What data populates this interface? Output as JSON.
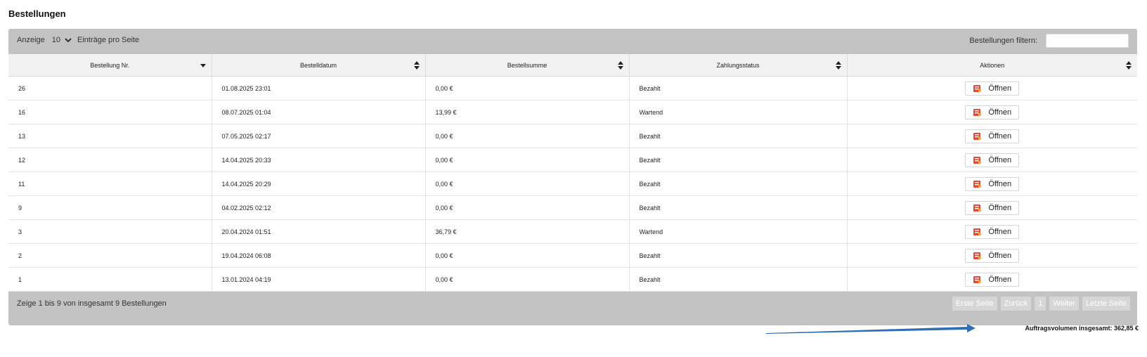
{
  "page": {
    "title": "Bestellungen"
  },
  "controls": {
    "length_prefix": "Anzeige",
    "length_value": "10",
    "length_suffix": "Einträge pro Seite",
    "filter_label": "Bestellungen filtern:",
    "filter_value": ""
  },
  "table": {
    "columns": [
      "Bestellung Nr.",
      "Bestelldatum",
      "Bestellsumme",
      "Zahlungsstatus",
      "Aktionen"
    ],
    "rows": [
      {
        "nr": "26",
        "datum": "01.08.2025 23:01",
        "summe": "0,00 €",
        "status": "Bezahlt",
        "aktion": "Öffnen"
      },
      {
        "nr": "16",
        "datum": "08.07.2025 01:04",
        "summe": "13,99 €",
        "status": "Wartend",
        "aktion": "Öffnen"
      },
      {
        "nr": "13",
        "datum": "07.05.2025 02:17",
        "summe": "0,00 €",
        "status": "Bezahlt",
        "aktion": "Öffnen"
      },
      {
        "nr": "12",
        "datum": "14.04.2025 20:33",
        "summe": "0,00 €",
        "status": "Bezahlt",
        "aktion": "Öffnen"
      },
      {
        "nr": "11",
        "datum": "14.04.2025 20:29",
        "summe": "0,00 €",
        "status": "Bezahlt",
        "aktion": "Öffnen"
      },
      {
        "nr": "9",
        "datum": "04.02.2025 02:12",
        "summe": "0,00 €",
        "status": "Bezahlt",
        "aktion": "Öffnen"
      },
      {
        "nr": "3",
        "datum": "20.04.2024 01:51",
        "summe": "36,79 €",
        "status": "Wartend",
        "aktion": "Öffnen"
      },
      {
        "nr": "2",
        "datum": "19.04.2024 06:08",
        "summe": "0,00 €",
        "status": "Bezahlt",
        "aktion": "Öffnen"
      },
      {
        "nr": "1",
        "datum": "13.01.2024 04:19",
        "summe": "0,00 €",
        "status": "Bezahlt",
        "aktion": "Öffnen"
      }
    ]
  },
  "footer": {
    "info": "Zeige 1 bis 9 von insgesamt 9 Bestellungen",
    "pager": [
      "Erste Seite",
      "Zurück",
      "1",
      "Weiter",
      "Letzte Seite"
    ]
  },
  "summary": {
    "total": "Auftragsvolumen insgesamt: 362,85 €"
  },
  "colors": {
    "header_bar": "#c3c3c3",
    "arrow": "#2f6db5",
    "icon_red": "#e04b3a",
    "icon_orange": "#f2a23a"
  },
  "icons": {
    "length_dropdown": "chevron-down-icon",
    "sort": "sort-icon",
    "open": "open-order-icon"
  }
}
